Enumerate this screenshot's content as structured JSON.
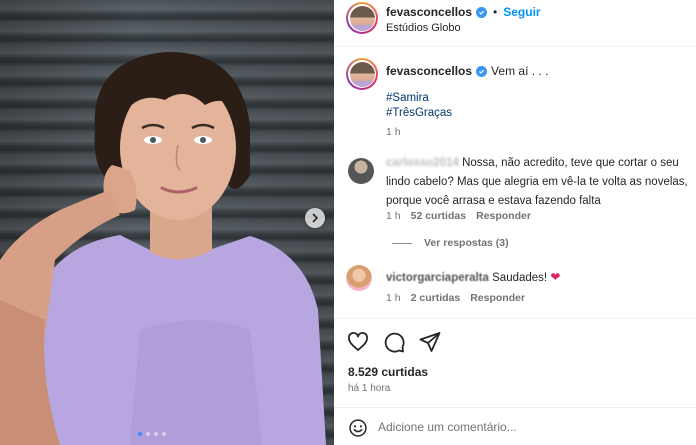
{
  "post": {
    "author": "fevasconcellos",
    "follow_label": "Seguir",
    "separator": "•",
    "location": "Estúdios Globo",
    "caption_text": "Vem aí . . .",
    "hashtags": [
      "#Samira",
      "#TrêsGraças"
    ],
    "caption_time": "1 h",
    "likes": "8.529 curtidas",
    "posted_ago": "há 1 hora",
    "carousel_slides": 4,
    "carousel_active": 0
  },
  "comments": [
    {
      "username": "carlosso2014",
      "text": "Nossa, não acredito, teve que cortar o seu lindo cabelo? Mas que alegria em vê-la te volta as novelas, porque você arrasa e estava fazendo falta",
      "time": "1 h",
      "likes": "52 curtidas",
      "reply_label": "Responder",
      "view_replies": "Ver respostas (3)"
    },
    {
      "username": "victorgarciaperalta",
      "text": "Saudades!",
      "emoji": "❤",
      "time": "1 h",
      "likes": "2 curtidas",
      "reply_label": "Responder"
    }
  ],
  "composer": {
    "placeholder": "Adicione um comentário..."
  },
  "icons": [
    "verified-badge-icon",
    "heart-icon",
    "comment-icon",
    "share-icon",
    "emoji-icon",
    "chevron-right-icon"
  ],
  "colors": {
    "accent": "#0095f6",
    "hashtag": "#00376b",
    "muted": "#737373",
    "verified": "#3897f0",
    "shirt": "#b8a6e0"
  }
}
